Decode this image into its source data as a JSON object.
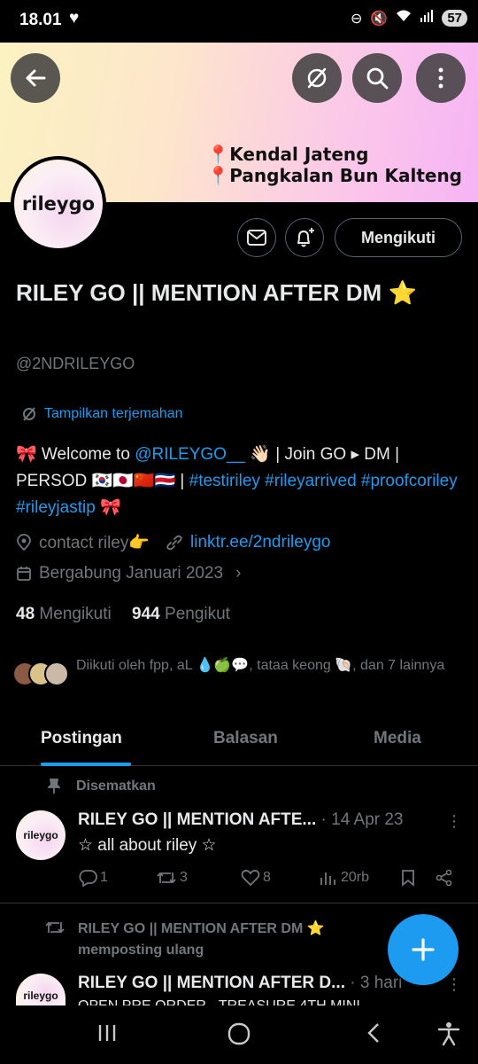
{
  "status_bar": {
    "time": "18.01",
    "battery": "57"
  },
  "banner": {
    "line1": "Kendal Jateng",
    "line2": "Pangkalan Bun Kalteng",
    "gradient": [
      "#fbf2c1",
      "#f6b4f5"
    ]
  },
  "profile": {
    "avatar_text": "rileygo",
    "follow_label": "Mengikuti",
    "display_name": "RILEY GO || MENTION AFTER DM ⭐",
    "handle": "@2NDRILEYGO",
    "translate_label": "Tampilkan terjemahan",
    "bio": {
      "p1": "🎀 Welcome to ",
      "mention": "@RILEYGO__",
      "p2": " 👋🏻 | Join GO ▸ DM | PERSOD 🇰🇷🇯🇵🇨🇳🇨🇷 | ",
      "hashtags": "#testiriley #rileyarrived #proofcoriley #rileyjastip",
      "p3": " 🎀"
    },
    "location": "contact riley👉",
    "website": "linktr.ee/2ndrileygo",
    "joined": "Bergabung Januari 2023",
    "following_count": "48",
    "following_label": "Mengikuti",
    "followers_count": "944",
    "followers_label": "Pengikut",
    "followed_by": "Diikuti oleh fpp, aL 💧🍏💬, tataa keong 🐚, dan 7 lainnya"
  },
  "tabs": [
    "Postingan",
    "Balasan",
    "Media"
  ],
  "pinned_tweet": {
    "pinned_label": "Disematkan",
    "name": "RILEY GO || MENTION AFTE...",
    "date": "· 14 Apr 23",
    "text": "☆ all about riley ☆",
    "replies": "1",
    "retweets": "3",
    "likes": "8",
    "views": "20rb"
  },
  "next_tweet": {
    "retweet_label": "RILEY GO || MENTION AFTER DM ⭐ memposting ulang",
    "name": "RILEY GO || MENTION AFTER D...",
    "date": "· 3 hari",
    "text": "OPEN PRE ORDER - TREASURE 4TH MINI"
  },
  "colors": {
    "accent": "#1d9bf0",
    "background": "#000000",
    "muted": "#71767b",
    "text": "#e7e9ea"
  }
}
